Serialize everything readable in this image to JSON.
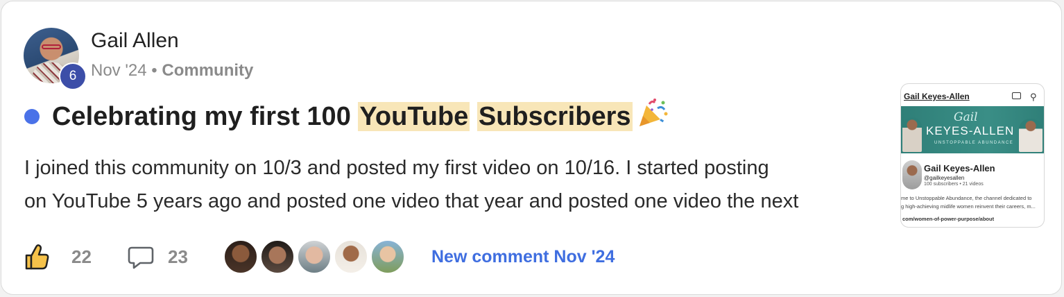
{
  "topic": {
    "author": "Gail Allen",
    "author_level_badge": "6",
    "date": "Nov '24",
    "separator": "•",
    "category": "Community",
    "status_dot_color": "#4a72e8",
    "title_part1": "Celebrating my first 100 ",
    "title_highlight1": "YouTube",
    "title_space": " ",
    "title_highlight2": "Subscribers",
    "title_emoji_icon": "party-popper-icon",
    "highlight_color": "#f8e6b8",
    "excerpt_line1": "I joined this community on 10/3 and posted my first video on 10/16. I started posting",
    "excerpt_line2": "on YouTube 5 years ago and posted one video that year and posted one video the next"
  },
  "footer": {
    "like_icon": "thumbs-up-icon",
    "likes": "22",
    "comment_icon": "speech-bubble-icon",
    "comments": "23",
    "participant_count": 5,
    "new_comment_label": "New comment Nov '24",
    "link_color": "#3f6ee0"
  },
  "thumbnail": {
    "channel_title": "Gail Keyes-Allen",
    "banner_script": "Gail",
    "banner_brand": "KEYES-ALLEN",
    "banner_tagline": "UNSTOPPABLE ABUNDANCE",
    "channel_name": "Gail Keyes-Allen",
    "handle": "@gailkeyesallen",
    "stats": "100 subscribers • 21 videos",
    "desc_line1": "me to Unstoppable Abundance, the channel dedicated to",
    "desc_line2": "g high-achieving midlife women reinvent their careers, m...",
    "link": "com/women-of-power-purpose/about",
    "cast_icon": "cast-icon",
    "search_icon": "search-icon"
  }
}
